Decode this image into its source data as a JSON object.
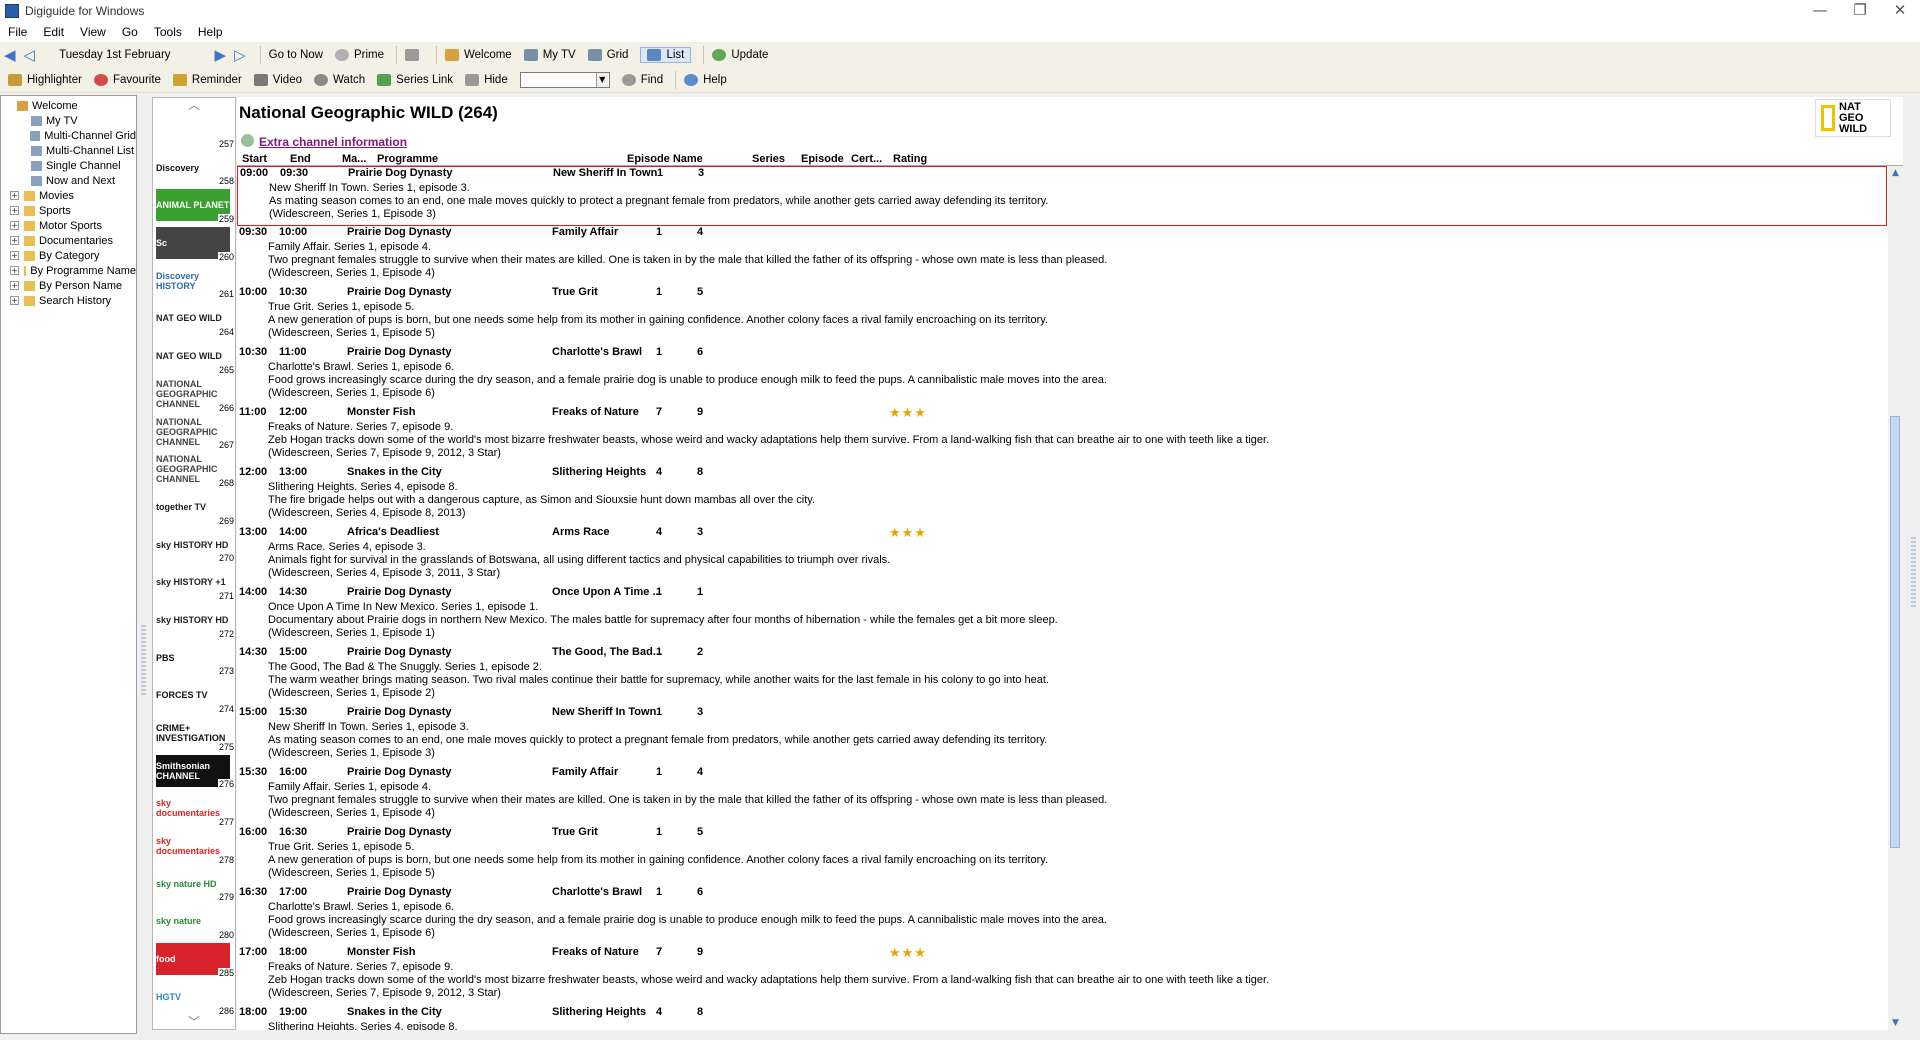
{
  "window": {
    "title": "Digiguide for Windows",
    "controls": [
      "—",
      "❐",
      "✕"
    ]
  },
  "menu": [
    "File",
    "Edit",
    "View",
    "Go",
    "Tools",
    "Help"
  ],
  "toolbar1": {
    "date": "Tuesday 1st February",
    "items": [
      {
        "label": "Go to Now",
        "color": "#f3f1e6"
      },
      {
        "label": "Prime",
        "color": "#b0b0b0"
      },
      {
        "label": "",
        "color": "#9a9a9a"
      },
      {
        "label": "Welcome",
        "color": "#d8a040"
      },
      {
        "label": "My TV",
        "color": "#7b8fa8"
      },
      {
        "label": "Grid",
        "color": "#7b8fa8"
      },
      {
        "label": "List",
        "color": "#5c87c0"
      },
      {
        "label": "Update",
        "color": "#5fa855"
      }
    ]
  },
  "toolbar2": {
    "items": [
      {
        "label": "Highlighter",
        "color": "#c79a3a"
      },
      {
        "label": "Favourite",
        "color": "#d84a4a"
      },
      {
        "label": "Reminder",
        "color": "#d0a030"
      },
      {
        "label": "Video",
        "color": "#7a7a7a"
      },
      {
        "label": "Watch",
        "color": "#8a8a8a"
      },
      {
        "label": "Series Link",
        "color": "#55a055"
      },
      {
        "label": "Hide",
        "color": "#9a9a9a"
      }
    ],
    "find": "Find",
    "help": "Help"
  },
  "tree": [
    {
      "label": "Welcome",
      "exp": "",
      "color": "#d8a040"
    },
    {
      "label": "My TV",
      "exp": "",
      "color": "#8aa0bc"
    },
    {
      "label": "Multi-Channel Grid",
      "exp": "",
      "color": "#8aa0bc"
    },
    {
      "label": "Multi-Channel List",
      "exp": "",
      "color": "#8aa0bc"
    },
    {
      "label": "Single Channel",
      "exp": "",
      "color": "#8aa0bc"
    },
    {
      "label": "Now and Next",
      "exp": "",
      "color": "#8aa0bc"
    },
    {
      "label": "Movies",
      "exp": "+",
      "color": "#e8c050"
    },
    {
      "label": "Sports",
      "exp": "+",
      "color": "#e8c050"
    },
    {
      "label": "Motor Sports",
      "exp": "+",
      "color": "#e8c050"
    },
    {
      "label": "Documentaries",
      "exp": "+",
      "color": "#e8c050"
    },
    {
      "label": "By Category",
      "exp": "+",
      "color": "#e8c050"
    },
    {
      "label": "By Programme Name",
      "exp": "+",
      "color": "#e8c050"
    },
    {
      "label": "By Person Name",
      "exp": "+",
      "color": "#e8c050"
    },
    {
      "label": "Search History",
      "exp": "+",
      "color": "#e8c050"
    }
  ],
  "channels": [
    {
      "num": "257",
      "name": "",
      "color": "#555",
      "bg": "#fff"
    },
    {
      "num": "258",
      "name": "Discovery",
      "color": "#111",
      "bg": "#fff"
    },
    {
      "num": "259",
      "name": "ANIMAL PLANET",
      "color": "#fff",
      "bg": "#3aa030"
    },
    {
      "num": "260",
      "name": "Sc",
      "color": "#fff",
      "bg": "#444"
    },
    {
      "num": "261",
      "name": "Discovery HISTORY",
      "color": "#2a6ab0",
      "bg": "#fff"
    },
    {
      "num": "264",
      "name": "NAT GEO WILD",
      "color": "#222",
      "bg": "#fff"
    },
    {
      "num": "265",
      "name": "NAT GEO WILD",
      "color": "#222",
      "bg": "#fff"
    },
    {
      "num": "266",
      "name": "NATIONAL GEOGRAPHIC CHANNEL",
      "color": "#444",
      "bg": "#fff"
    },
    {
      "num": "267",
      "name": "NATIONAL GEOGRAPHIC CHANNEL",
      "color": "#444",
      "bg": "#fff"
    },
    {
      "num": "268",
      "name": "NATIONAL GEOGRAPHIC CHANNEL",
      "color": "#444",
      "bg": "#fff"
    },
    {
      "num": "269",
      "name": "together TV",
      "color": "#222",
      "bg": "#fff"
    },
    {
      "num": "270",
      "name": "sky HISTORY HD",
      "color": "#222",
      "bg": "#fff"
    },
    {
      "num": "271",
      "name": "sky HISTORY +1",
      "color": "#222",
      "bg": "#fff"
    },
    {
      "num": "272",
      "name": "sky HISTORY HD",
      "color": "#222",
      "bg": "#fff"
    },
    {
      "num": "273",
      "name": "PBS",
      "color": "#111",
      "bg": "#fff"
    },
    {
      "num": "274",
      "name": "FORCES TV",
      "color": "#111",
      "bg": "#fff"
    },
    {
      "num": "275",
      "name": "CRIME+ INVESTIGATION",
      "color": "#111",
      "bg": "#fff"
    },
    {
      "num": "276",
      "name": "Smithsonian CHANNEL",
      "color": "#fff",
      "bg": "#111"
    },
    {
      "num": "277",
      "name": "sky documentaries",
      "color": "#d22",
      "bg": "#fff"
    },
    {
      "num": "278",
      "name": "sky documentaries",
      "color": "#d22",
      "bg": "#fff"
    },
    {
      "num": "279",
      "name": "sky nature HD",
      "color": "#2a8a3a",
      "bg": "#fff"
    },
    {
      "num": "280",
      "name": "sky nature",
      "color": "#2a8a3a",
      "bg": "#fff"
    },
    {
      "num": "285",
      "name": "food",
      "color": "#fff",
      "bg": "#d8232a"
    },
    {
      "num": "286",
      "name": "HGTV",
      "color": "#2a8ac0",
      "bg": "#fff"
    }
  ],
  "channel": {
    "title": "National Geographic WILD (264)",
    "extra": "Extra channel information",
    "logo": "NAT GEO WILD"
  },
  "columns": [
    "Start",
    "End",
    "Ma...",
    "Programme",
    "Episode Name",
    "Series",
    "Episode",
    "Cert...",
    "Rating"
  ],
  "programmes": [
    {
      "start": "09:00",
      "end": "09:30",
      "title": "Prairie Dog Dynasty",
      "episode": "New Sheriff In Town",
      "series": "1",
      "ep": "3",
      "stars": "",
      "selected": true,
      "lines": [
        "New Sheriff In Town. Series 1, episode 3.",
        "As mating season comes to an end, one male moves quickly to protect a pregnant female from predators, while another gets carried away defending its territory.",
        "(Widescreen, Series 1, Episode 3)"
      ]
    },
    {
      "start": "09:30",
      "end": "10:00",
      "title": "Prairie Dog Dynasty",
      "episode": "Family Affair",
      "series": "1",
      "ep": "4",
      "stars": "",
      "lines": [
        "Family Affair. Series 1, episode 4.",
        "Two pregnant females struggle to survive when their mates are killed. One is taken in by the male that killed the father of its offspring - whose own mate is less than pleased.",
        "(Widescreen, Series 1, Episode 4)"
      ]
    },
    {
      "start": "10:00",
      "end": "10:30",
      "title": "Prairie Dog Dynasty",
      "episode": "True Grit",
      "series": "1",
      "ep": "5",
      "stars": "",
      "lines": [
        "True Grit. Series 1, episode 5.",
        "A new generation of pups is born, but one needs some help from its mother in gaining confidence. Another colony faces a rival family encroaching on its territory.",
        "(Widescreen, Series 1, Episode 5)"
      ]
    },
    {
      "start": "10:30",
      "end": "11:00",
      "title": "Prairie Dog Dynasty",
      "episode": "Charlotte's Brawl",
      "series": "1",
      "ep": "6",
      "stars": "",
      "lines": [
        "Charlotte's Brawl. Series 1, episode 6.",
        "Food grows increasingly scarce during the dry season, and a female prairie dog is unable to produce enough milk to feed the pups. A cannibalistic male moves into the area.",
        "(Widescreen, Series 1, Episode 6)"
      ]
    },
    {
      "start": "11:00",
      "end": "12:00",
      "title": "Monster Fish",
      "episode": "Freaks of Nature",
      "series": "7",
      "ep": "9",
      "stars": "★★★",
      "lines": [
        "Freaks of Nature. Series 7, episode 9.",
        "Zeb Hogan tracks down some of the world's most bizarre freshwater beasts, whose weird and wacky adaptations help them survive. From a land-walking fish that can breathe air to one with teeth like a tiger.",
        "(Widescreen, Series 7, Episode 9, 2012, 3 Star)"
      ]
    },
    {
      "start": "12:00",
      "end": "13:00",
      "title": "Snakes in the City",
      "episode": "Slithering Heights",
      "series": "4",
      "ep": "8",
      "stars": "",
      "lines": [
        "Slithering Heights. Series 4, episode 8.",
        "The fire brigade helps out with a dangerous capture, as Simon and Siouxsie hunt down mambas all over the city.",
        "(Widescreen, Series 4, Episode 8, 2013)"
      ]
    },
    {
      "start": "13:00",
      "end": "14:00",
      "title": "Africa's Deadliest",
      "episode": "Arms Race",
      "series": "4",
      "ep": "3",
      "stars": "★★★",
      "lines": [
        "Arms Race. Series 4, episode 3.",
        "Animals fight for survival in the grasslands of Botswana, all using different tactics and physical capabilities to triumph over rivals.",
        "(Widescreen, Series 4, Episode 3, 2011, 3 Star)"
      ]
    },
    {
      "start": "14:00",
      "end": "14:30",
      "title": "Prairie Dog Dynasty",
      "episode": "Once Upon A Time ...",
      "series": "1",
      "ep": "1",
      "stars": "",
      "lines": [
        "Once Upon A Time In New Mexico. Series 1, episode 1.",
        "Documentary about Prairie dogs in northern New Mexico. The males battle for supremacy after four months of hibernation - while the females get a bit more sleep.",
        "(Widescreen, Series 1, Episode 1)"
      ]
    },
    {
      "start": "14:30",
      "end": "15:00",
      "title": "Prairie Dog Dynasty",
      "episode": "The Good, The Bad...",
      "series": "1",
      "ep": "2",
      "stars": "",
      "lines": [
        "The Good, The Bad & The Snuggly. Series 1, episode 2.",
        "The warm weather brings mating season. Two rival males continue their battle for supremacy, while another waits for the last female in his colony to go into heat.",
        "(Widescreen, Series 1, Episode 2)"
      ]
    },
    {
      "start": "15:00",
      "end": "15:30",
      "title": "Prairie Dog Dynasty",
      "episode": "New Sheriff In Town",
      "series": "1",
      "ep": "3",
      "stars": "",
      "lines": [
        "New Sheriff In Town. Series 1, episode 3.",
        "As mating season comes to an end, one male moves quickly to protect a pregnant female from predators, while another gets carried away defending its territory.",
        "(Widescreen, Series 1, Episode 3)"
      ]
    },
    {
      "start": "15:30",
      "end": "16:00",
      "title": "Prairie Dog Dynasty",
      "episode": "Family Affair",
      "series": "1",
      "ep": "4",
      "stars": "",
      "lines": [
        "Family Affair. Series 1, episode 4.",
        "Two pregnant females struggle to survive when their mates are killed. One is taken in by the male that killed the father of its offspring - whose own mate is less than pleased.",
        "(Widescreen, Series 1, Episode 4)"
      ]
    },
    {
      "start": "16:00",
      "end": "16:30",
      "title": "Prairie Dog Dynasty",
      "episode": "True Grit",
      "series": "1",
      "ep": "5",
      "stars": "",
      "lines": [
        "True Grit. Series 1, episode 5.",
        "A new generation of pups is born, but one needs some help from its mother in gaining confidence. Another colony faces a rival family encroaching on its territory.",
        "(Widescreen, Series 1, Episode 5)"
      ]
    },
    {
      "start": "16:30",
      "end": "17:00",
      "title": "Prairie Dog Dynasty",
      "episode": "Charlotte's Brawl",
      "series": "1",
      "ep": "6",
      "stars": "",
      "lines": [
        "Charlotte's Brawl. Series 1, episode 6.",
        "Food grows increasingly scarce during the dry season, and a female prairie dog is unable to produce enough milk to feed the pups. A cannibalistic male moves into the area.",
        "(Widescreen, Series 1, Episode 6)"
      ]
    },
    {
      "start": "17:00",
      "end": "18:00",
      "title": "Monster Fish",
      "episode": "Freaks of Nature",
      "series": "7",
      "ep": "9",
      "stars": "★★★",
      "lines": [
        "Freaks of Nature. Series 7, episode 9.",
        "Zeb Hogan tracks down some of the world's most bizarre freshwater beasts, whose weird and wacky adaptations help them survive. From a land-walking fish that can breathe air to one with teeth like a tiger.",
        "(Widescreen, Series 7, Episode 9, 2012, 3 Star)"
      ]
    },
    {
      "start": "18:00",
      "end": "19:00",
      "title": "Snakes in the City",
      "episode": "Slithering Heights",
      "series": "4",
      "ep": "8",
      "stars": "",
      "lines": [
        "Slithering Heights. Series 4, episode 8.",
        "",
        ""
      ]
    }
  ]
}
